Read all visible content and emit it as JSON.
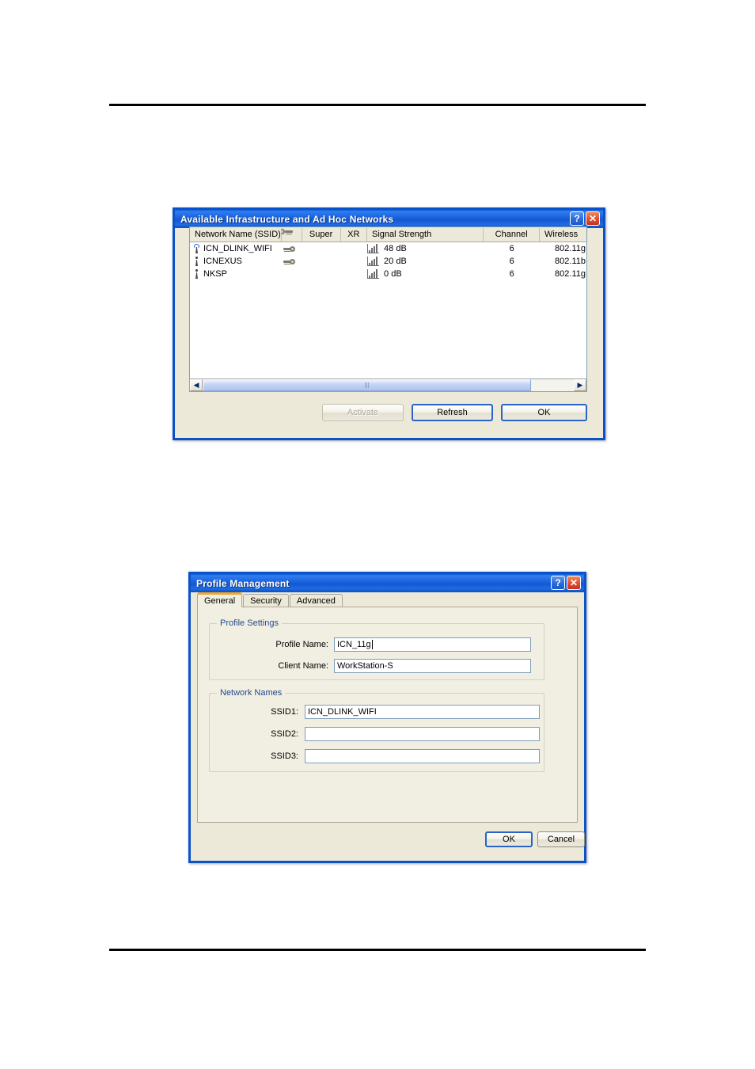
{
  "page": {
    "rule_top": "",
    "rule_bottom": ""
  },
  "networks_dialog": {
    "title": "Available Infrastructure and Ad Hoc Networks",
    "help_button": "?",
    "close_button": "✕",
    "columns": [
      "Network Name (SSID)",
      "",
      "Super",
      "XR",
      "Signal Strength",
      "Channel",
      "Wireless"
    ],
    "rows": [
      {
        "ssid": "ICN_DLINK_WIFI",
        "network_type": "infrastructure",
        "encrypted": true,
        "super": "",
        "xr": "",
        "signal": "48 dB",
        "signal_bars": 4,
        "signal_level": "good",
        "channel": "6",
        "wireless": "802.11g"
      },
      {
        "ssid": "ICNEXUS",
        "network_type": "ad-hoc",
        "encrypted": true,
        "super": "",
        "xr": "",
        "signal": "20 dB",
        "signal_bars": 4,
        "signal_level": "good",
        "channel": "6",
        "wireless": "802.11b"
      },
      {
        "ssid": "NKSP",
        "network_type": "ad-hoc",
        "encrypted": false,
        "super": "",
        "xr": "",
        "signal": "0 dB",
        "signal_bars": 1,
        "signal_level": "low",
        "channel": "6",
        "wireless": "802.11g"
      }
    ],
    "scrollbar": {
      "left_arrow": "◀",
      "right_arrow": "▶"
    },
    "buttons": {
      "activate": "Activate",
      "refresh": "Refresh",
      "ok": "OK"
    }
  },
  "profile_dialog": {
    "title": "Profile Management",
    "help_button": "?",
    "close_button": "✕",
    "tabs": [
      {
        "label": "General",
        "active": true
      },
      {
        "label": "Security",
        "active": false
      },
      {
        "label": "Advanced",
        "active": false
      }
    ],
    "profile_settings": {
      "group_title": "Profile Settings",
      "profile_name_label": "Profile Name:",
      "profile_name_value": "ICN_11g",
      "client_name_label": "Client Name:",
      "client_name_value": "WorkStation-S"
    },
    "network_names": {
      "group_title": "Network Names",
      "ssid1_label": "SSID1:",
      "ssid1_value": "ICN_DLINK_WIFI",
      "ssid2_label": "SSID2:",
      "ssid2_value": "",
      "ssid3_label": "SSID3:",
      "ssid3_value": ""
    },
    "buttons": {
      "ok": "OK",
      "cancel": "Cancel"
    }
  },
  "colors": {
    "titlebar_blue": "#1358d4",
    "dialog_face": "#ece9d8",
    "panel_face": "#f1efe2",
    "group_title": "#264a8c",
    "signal_good": "#17c017",
    "signal_low": "#dd1111",
    "tab_accent": "#f0a830",
    "close_red": "#c4321c"
  }
}
